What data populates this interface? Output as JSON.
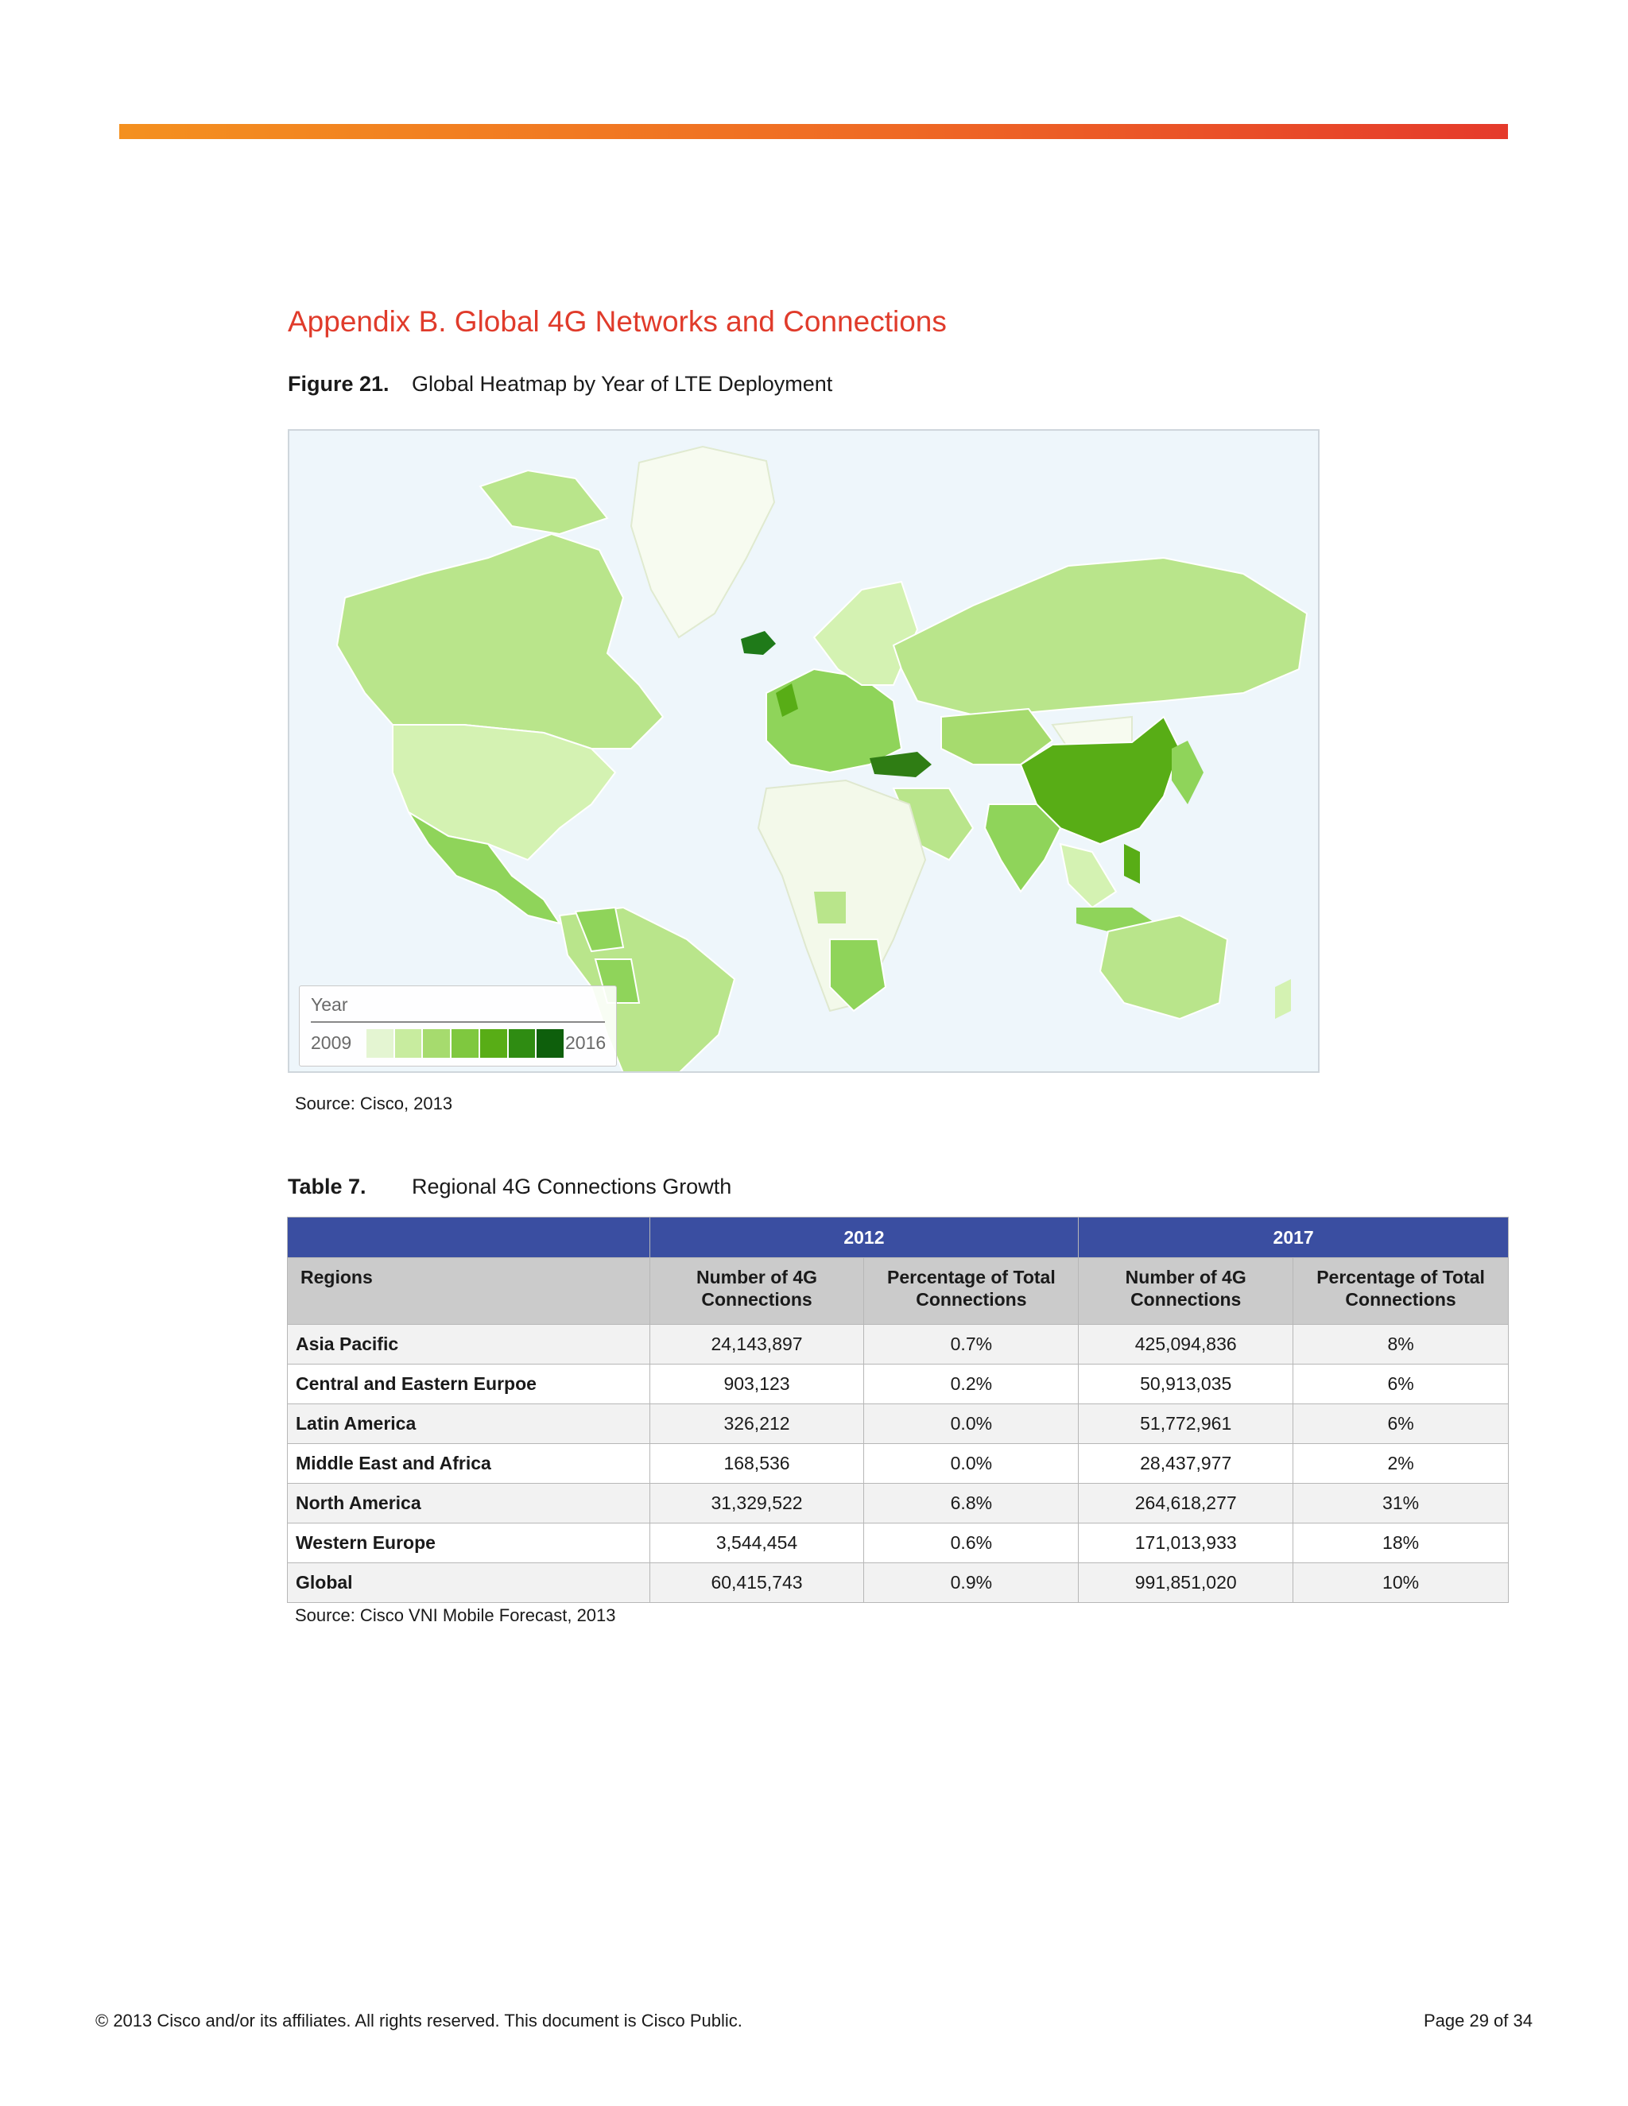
{
  "heading": "Appendix B. Global 4G Networks and Connections",
  "figure": {
    "number": "Figure 21.",
    "title": "Global Heatmap by Year of LTE Deployment",
    "legend": {
      "title": "Year",
      "min": "2009",
      "max": "2016",
      "colors": [
        "#e4f5d2",
        "#c8ec9f",
        "#a6db6e",
        "#7fc83f",
        "#58ad16",
        "#2f8c12",
        "#0e5f0c"
      ]
    },
    "source": "Source: Cisco, 2013"
  },
  "table": {
    "number": "Table 7.",
    "title": "Regional 4G Connections Growth",
    "year_headers": [
      "2012",
      "2017"
    ],
    "column_headers": [
      "Regions",
      "Number of 4G Connections",
      "Percentage of Total Connections",
      "Number of 4G Connections",
      "Percentage of Total Connections"
    ],
    "rows": [
      [
        "Asia Pacific",
        "24,143,897",
        "0.7%",
        "425,094,836",
        "8%"
      ],
      [
        "Central and Eastern Eurpoe",
        "903,123",
        "0.2%",
        "50,913,035",
        "6%"
      ],
      [
        "Latin America",
        "326,212",
        "0.0%",
        "51,772,961",
        "6%"
      ],
      [
        "Middle East and Africa",
        "168,536",
        "0.0%",
        "28,437,977",
        "2%"
      ],
      [
        "North America",
        "31,329,522",
        "6.8%",
        "264,618,277",
        "31%"
      ],
      [
        "Western Europe",
        "3,544,454",
        "0.6%",
        "171,013,933",
        "18%"
      ],
      [
        "Global",
        "60,415,743",
        "0.9%",
        "991,851,020",
        "10%"
      ]
    ],
    "source": "Source: Cisco VNI Mobile Forecast, 2013"
  },
  "footer": {
    "copyright": "© 2013 Cisco and/or its affiliates. All rights reserved. This document is Cisco Public.",
    "page": "Page 29 of 34"
  }
}
